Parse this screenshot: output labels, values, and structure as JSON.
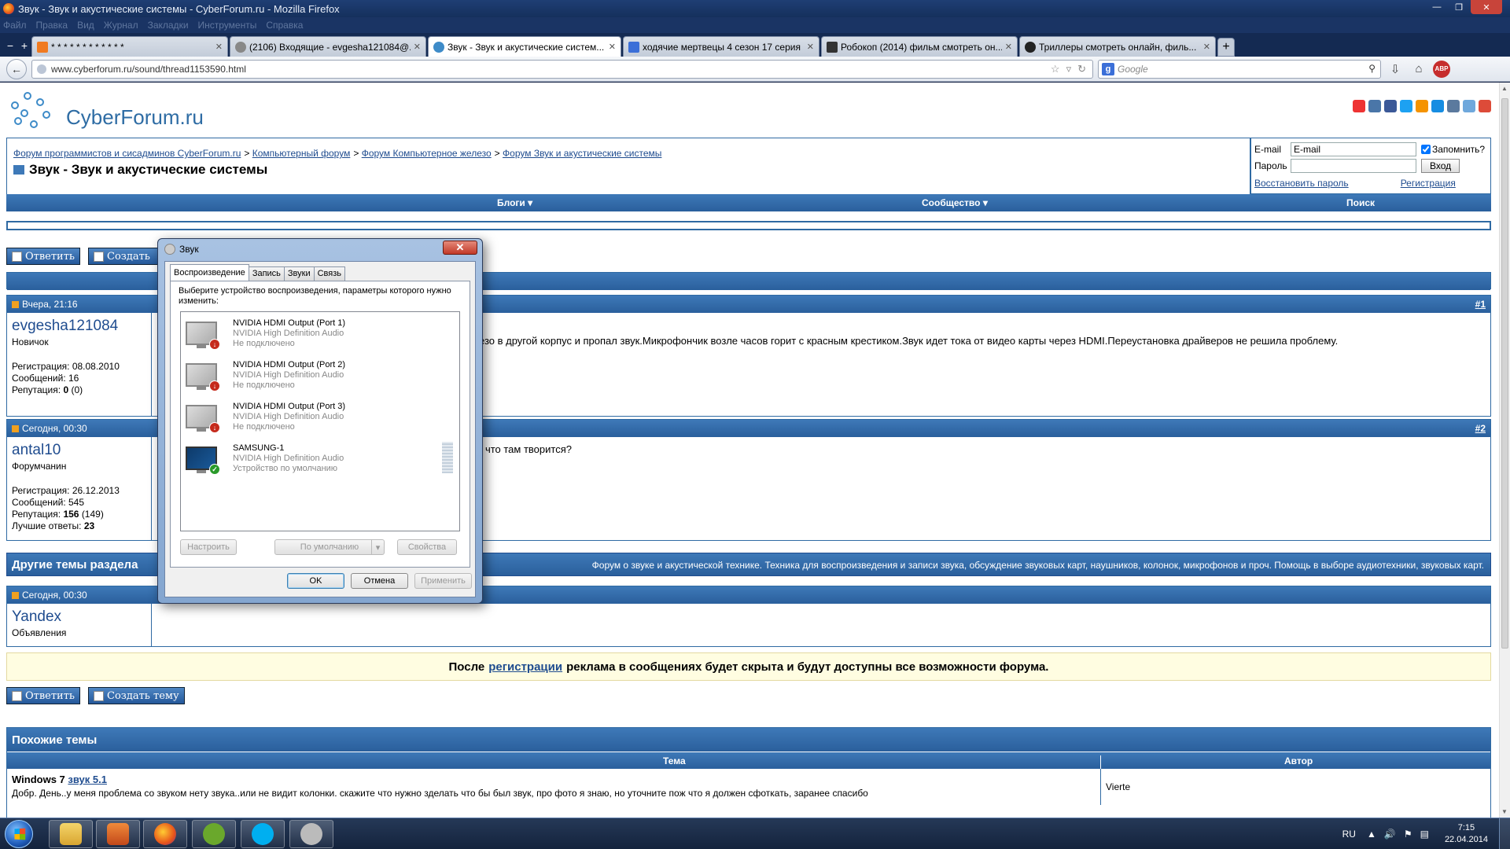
{
  "window": {
    "title": "Звук - Звук и акустические системы - CyberForum.ru - Mozilla Firefox"
  },
  "menu": [
    "Файл",
    "Правка",
    "Вид",
    "Журнал",
    "Закладки",
    "Инструменты",
    "Справка"
  ],
  "tabs": [
    {
      "label": "* * * * * * * * * * * *",
      "active": false
    },
    {
      "label": "(2106) Входящие - evgesha121084@...",
      "active": false
    },
    {
      "label": "Звук - Звук и акустические систем...",
      "active": true
    },
    {
      "label": "ходячие мертвецы 4 сезон 17 серия ...",
      "active": false
    },
    {
      "label": "Робокоп (2014) фильм смотреть он...",
      "active": false
    },
    {
      "label": "Триллеры смотреть онлайн, филь...",
      "active": false
    }
  ],
  "nav": {
    "url": "www.cyberforum.ru/sound/thread1153590.html",
    "search_placeholder": "Google",
    "abp": "ABP"
  },
  "site": {
    "logo_text": "CyberForum.ru"
  },
  "breadcrumb": {
    "items": [
      "Форум программистов и сисадминов CyberForum.ru",
      "Компьютерный форум",
      "Форум Компьютерное железо",
      "Форум Звук и акустические системы"
    ],
    "sep": ">"
  },
  "thread_title": "Звук - Звук и акустические системы",
  "login": {
    "email_label": "E-mail",
    "email_value": "E-mail",
    "remember": "Запомнить?",
    "password_label": "Пароль",
    "login_button": "Вход",
    "restore_link": "Восстановить пароль",
    "register_link": "Регистрация"
  },
  "navstrip": {
    "blogs": "Блоги",
    "community": "Сообщество",
    "search": "Поиск"
  },
  "actions": {
    "reply": "Ответить",
    "create": "Создать тему",
    "create_short": "Создать"
  },
  "posts": [
    {
      "date": "Вчера, 21:16",
      "num": "#1",
      "user": "evgesha121084",
      "rank": "Новичок",
      "reg": "Регистрация: 08.08.2010",
      "msgs": "Сообщений: 16",
      "rep_label": "Репутация:",
      "rep_value": "0",
      "rep_extra": "(0)",
      "text": "езо в другой корпус и пропал звук.Микрофончик возле часов горит с красным крестиком.Звук идет тока от видео карты через HDMI.Переустановка драйверов не решила проблему."
    },
    {
      "date": "Сегодня, 00:30",
      "num": "#2",
      "user": "antal10",
      "rank": "Форумчанин",
      "reg": "Регистрация: 26.12.2013",
      "msgs": "Сообщений: 545",
      "rep_label": "Репутация:",
      "rep_value": "156",
      "rep_extra": "(149)",
      "best_label": "Лучшие ответы:",
      "best_value": "23",
      "text": "- что там творится?"
    }
  ],
  "other_topics": {
    "title": "Другие темы раздела",
    "desc": "Форум о звуке и акустической технике. Техника для воспроизведения и записи звука, обсуждение звуковых карт, наушников, колонок, микрофонов и проч. Помощь в выборе аудиотехники, звуковых карт."
  },
  "ad_post": {
    "date": "Сегодня, 00:30",
    "user": "Yandex",
    "rank": "Объявления"
  },
  "ad_bar": {
    "before": "После",
    "link": "регистрации",
    "after": "реклама в сообщениях будет скрыта и будут доступны все возможности форума."
  },
  "similar": {
    "title": "Похожие темы",
    "col_topic": "Тема",
    "col_author": "Автор",
    "rows": [
      {
        "title_plain": "Windows 7",
        "title_link": "звук 5.1",
        "desc": "Добр. День..у меня проблема со звуком нету звука..или не видит колонки. скажите что нужно зделать что бы был звук, про фото я знаю, но уточните пож что я должен сфоткать, заранее спасибо",
        "author": "Vierte"
      }
    ]
  },
  "dialog": {
    "title": "Звук",
    "tabs": [
      "Воспроизведение",
      "Запись",
      "Звуки",
      "Связь"
    ],
    "instruction": "Выберите устройство воспроизведения, параметры которого нужно изменить:",
    "devices": [
      {
        "name": "NVIDIA HDMI Output (Port 1)",
        "driver": "NVIDIA High Definition Audio",
        "status": "Не подключено",
        "state": "disconnected"
      },
      {
        "name": "NVIDIA HDMI Output (Port 2)",
        "driver": "NVIDIA High Definition Audio",
        "status": "Не подключено",
        "state": "disconnected"
      },
      {
        "name": "NVIDIA HDMI Output (Port 3)",
        "driver": "NVIDIA High Definition Audio",
        "status": "Не подключено",
        "state": "disconnected"
      },
      {
        "name": "SAMSUNG-1",
        "driver": "NVIDIA High Definition Audio",
        "status": "Устройство по умолчанию",
        "state": "default"
      }
    ],
    "configure": "Настроить",
    "default": "По умолчанию",
    "properties": "Свойства",
    "ok": "OK",
    "cancel": "Отмена",
    "apply": "Применить"
  },
  "taskbar": {
    "lang": "RU",
    "time": "7:15",
    "date": "22.04.2014"
  }
}
